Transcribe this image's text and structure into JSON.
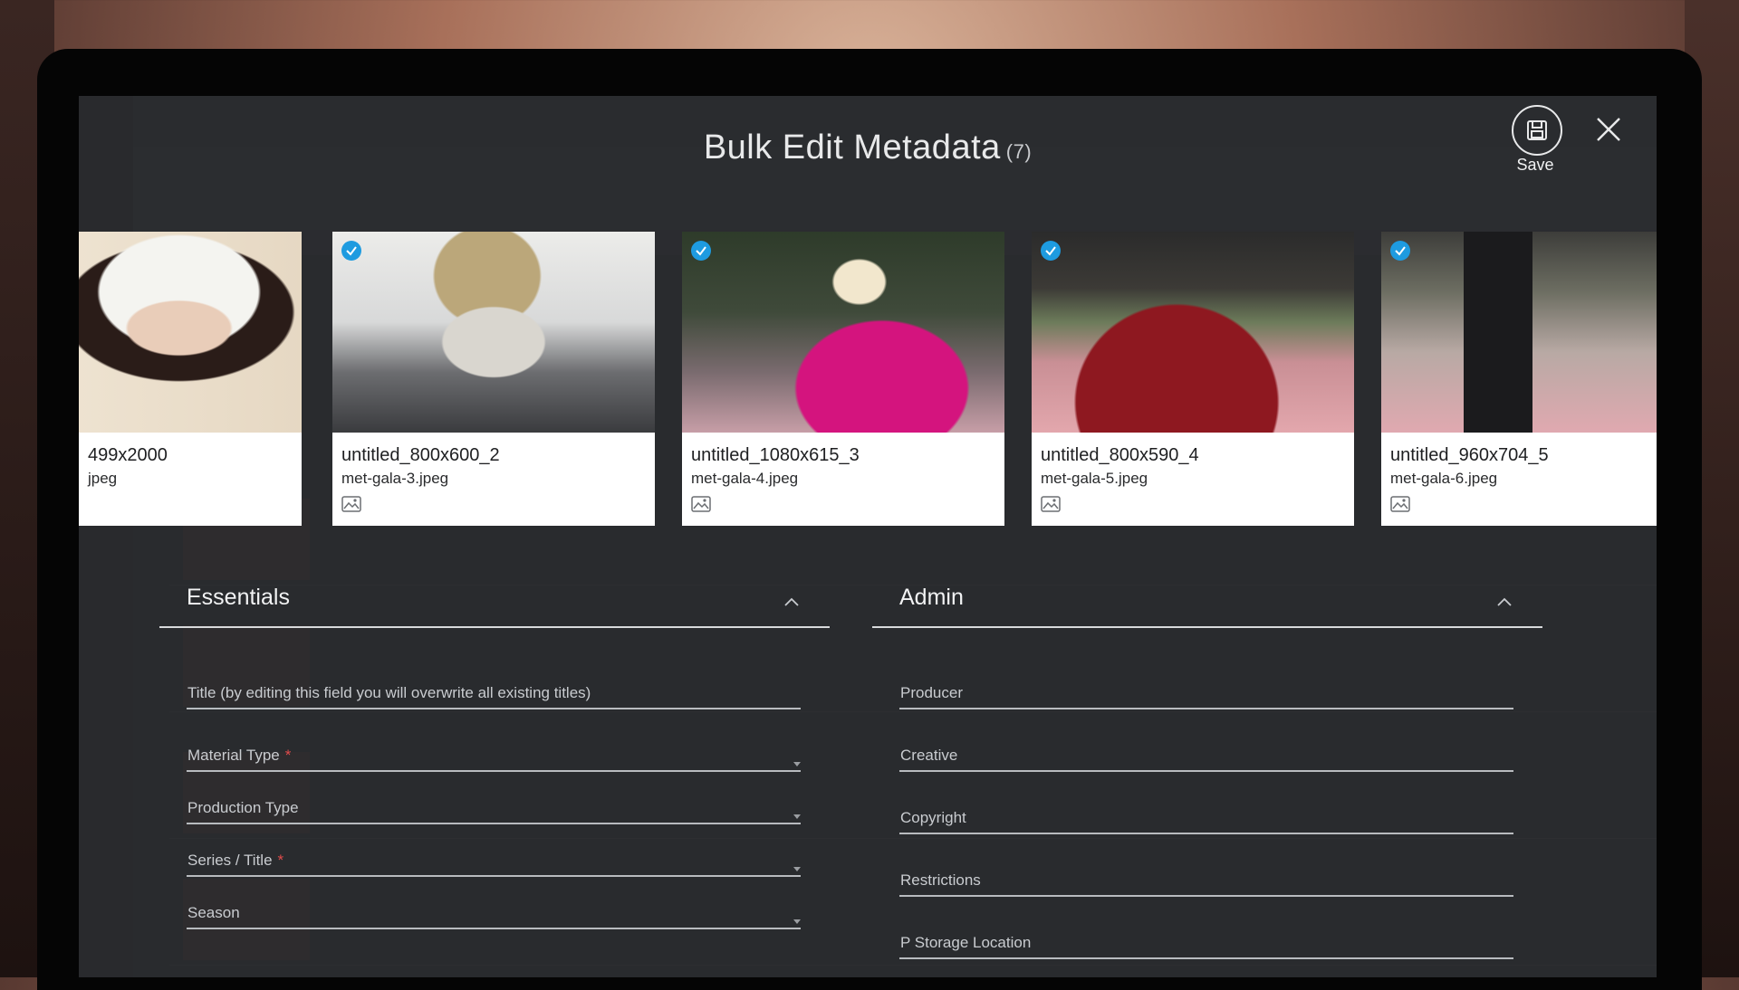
{
  "modal": {
    "title": "Bulk Edit Metadata",
    "count": "(7)",
    "save_label": "Save"
  },
  "cards": [
    {
      "name": "499x2000",
      "file": "jpeg",
      "checked": false
    },
    {
      "name": "untitled_800x600_2",
      "file": "met-gala-3.jpeg",
      "checked": true
    },
    {
      "name": "untitled_1080x615_3",
      "file": "met-gala-4.jpeg",
      "checked": true
    },
    {
      "name": "untitled_800x590_4",
      "file": "met-gala-5.jpeg",
      "checked": true
    },
    {
      "name": "untitled_960x704_5",
      "file": "met-gala-6.jpeg",
      "checked": true
    }
  ],
  "essentials": {
    "title": "Essentials",
    "fields": [
      {
        "label": "Title (by editing this field you will overwrite all existing titles)",
        "required": false,
        "dropdown": false
      },
      {
        "label": "Material Type",
        "required": true,
        "dropdown": true
      },
      {
        "label": "Production Type",
        "required": false,
        "dropdown": true
      },
      {
        "label": "Series / Title",
        "required": true,
        "dropdown": true
      },
      {
        "label": "Season",
        "required": false,
        "dropdown": true
      }
    ]
  },
  "admin": {
    "title": "Admin",
    "fields": [
      {
        "label": "Producer"
      },
      {
        "label": "Creative"
      },
      {
        "label": "Copyright"
      },
      {
        "label": "Restrictions"
      },
      {
        "label": "P Storage Location"
      }
    ]
  },
  "colors": {
    "accent_check": "#1e9be0",
    "required": "#e04b4b",
    "overlay": "#2e3033"
  },
  "icons": [
    "save-icon",
    "close-icon",
    "check-icon",
    "image-icon",
    "chevron-up-icon",
    "dropdown-arrow-icon"
  ]
}
